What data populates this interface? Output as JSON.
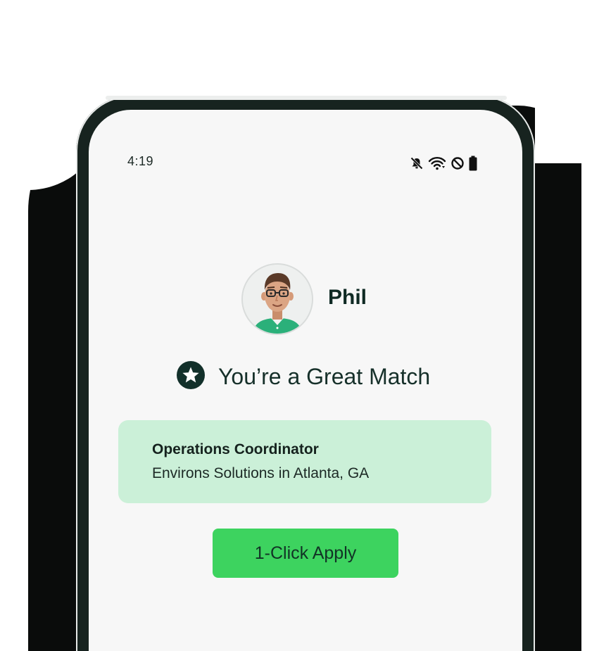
{
  "status_bar": {
    "time": "4:19",
    "icons": [
      "mute-icon",
      "wifi-icon",
      "do-not-disturb-icon",
      "battery-icon"
    ]
  },
  "profile": {
    "name": "Phil",
    "avatar": "avatar-illustration"
  },
  "match": {
    "icon": "star-icon",
    "text": "You’re a Great Match"
  },
  "job": {
    "title": "Operations Coordinator",
    "company_location": "Environs Solutions in Atlanta, GA"
  },
  "actions": {
    "apply_label": "1-Click Apply"
  },
  "colors": {
    "screen_bg": "#f7f7f7",
    "frame": "#17231f",
    "card_bg": "#cbf0d8",
    "button_bg": "#3dd35f",
    "text_dark": "#0f2a24"
  }
}
